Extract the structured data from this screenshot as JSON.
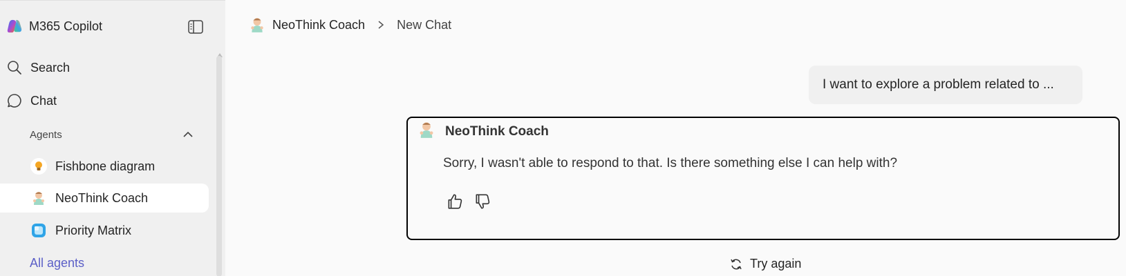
{
  "sidebar": {
    "app_name": "M365 Copilot",
    "nav": [
      {
        "label": "Search",
        "icon": "search-icon"
      },
      {
        "label": "Chat",
        "icon": "chat-bubble-icon"
      }
    ],
    "agents_section": "Agents",
    "agents": [
      {
        "label": "Fishbone diagram",
        "icon": "lightbulb-icon",
        "active": false
      },
      {
        "label": "NeoThink Coach",
        "icon": "baby-avatar-icon",
        "active": true
      },
      {
        "label": "Priority Matrix",
        "icon": "matrix-app-icon",
        "active": false
      }
    ],
    "all_agents": "All agents"
  },
  "header": {
    "agent_name": "NeoThink Coach",
    "separator": ">",
    "crumb": "New Chat"
  },
  "chat": {
    "user_message": "I want to explore a problem related to ...",
    "bot_name": "NeoThink Coach",
    "bot_message": "Sorry, I wasn't able to respond to that. Is there something else I can help with?",
    "retry_label": "Try again"
  },
  "colors": {
    "link": "#5b5fc7",
    "sidebar_bg": "#f0f0f0",
    "page_bg": "#fafafa"
  }
}
